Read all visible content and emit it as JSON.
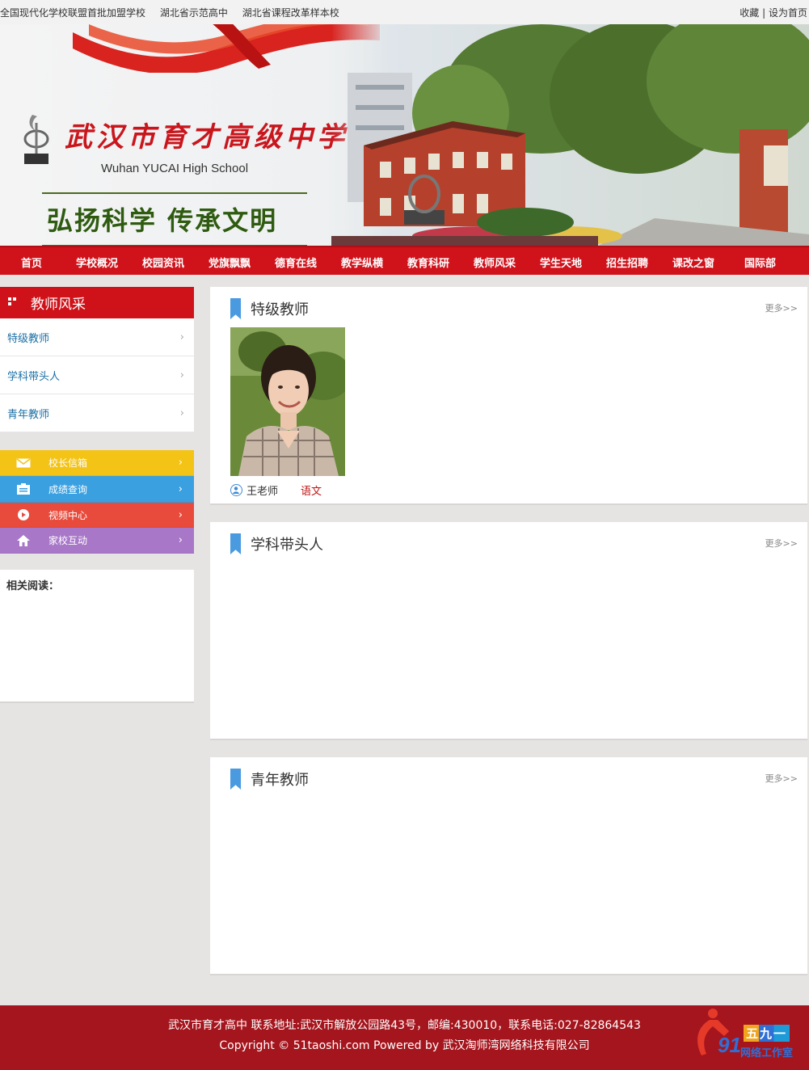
{
  "topbar": {
    "tags": [
      "全国现代化学校联盟首批加盟学校",
      "湖北省示范高中",
      "湖北省课程改革样本校"
    ],
    "favorite": "收藏",
    "separator": "|",
    "set_home": "设为首页"
  },
  "banner": {
    "cn_title": "武汉市育才高级中学",
    "en_title": "Wuhan YUCAI High School",
    "slogan": "弘扬科学  传承文明"
  },
  "nav": {
    "items": [
      "首页",
      "学校概况",
      "校园资讯",
      "党旗飘飘",
      "德育在线",
      "教学纵横",
      "教育科研",
      "教师风采",
      "学生天地",
      "招生招聘",
      "课改之窗",
      "国际部"
    ]
  },
  "sidebar": {
    "title": "教师风采",
    "items": [
      {
        "label": "特级教师",
        "arrow": "›"
      },
      {
        "label": "学科带头人",
        "arrow": "›"
      },
      {
        "label": "青年教师",
        "arrow": "›"
      }
    ],
    "quick_links": [
      {
        "label": "校长信箱",
        "icon": "mail-icon",
        "color": "#f3c316"
      },
      {
        "label": "成绩查询",
        "icon": "document-icon",
        "color": "#3aa0e0"
      },
      {
        "label": "视频中心",
        "icon": "play-icon",
        "color": "#e84b3c"
      },
      {
        "label": "家校互动",
        "icon": "home-icon",
        "color": "#a877c8"
      }
    ],
    "related_title": "相关阅读："
  },
  "panels": [
    {
      "title": "特级教师",
      "more": "更多>>"
    },
    {
      "title": "学科带头人",
      "more": "更多>>"
    },
    {
      "title": "青年教师",
      "more": "更多>>"
    }
  ],
  "teacher": {
    "name": "王老师",
    "subject": "语文"
  },
  "footer": {
    "line1": "武汉市育才高中 联系地址:武汉市解放公园路43号，邮编:430010，联系电话:027-82864543",
    "line2": "Copyright © 51taoshi.com    Powered by 武汉淘师湾网络科技有限公司",
    "logo_number": "91",
    "logo_chars": "五九一",
    "logo_text": "网络工作室"
  },
  "colors": {
    "brand_red": "#d0121b",
    "footer_red": "#a5151d",
    "link_blue": "#1a6fa5"
  }
}
